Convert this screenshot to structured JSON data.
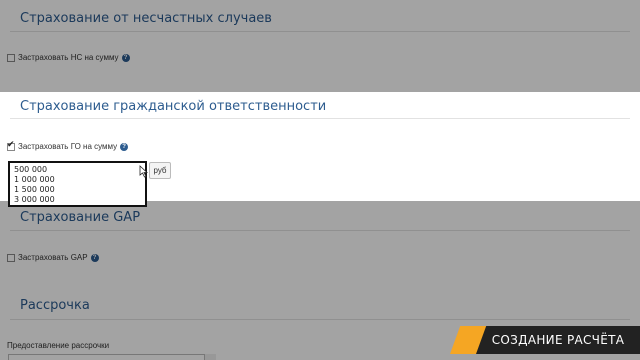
{
  "sections": [
    {
      "title": "Страхование от несчастных случаев",
      "checkbox_label": "Застраховать НС на сумму",
      "checked": false
    },
    {
      "title": "Страхование гражданской ответственности",
      "checkbox_label": "Застраховать ГО на сумму",
      "checked": true
    },
    {
      "title": "Страхование GAP",
      "checkbox_label": "Застраховать GAP",
      "checked": false
    },
    {
      "title": "Рассрочка",
      "field_label": "Предоставление рассрочки"
    }
  ],
  "go_amount": {
    "options": [
      "500 000",
      "1 000 000",
      "1 500 000",
      "3 000 000"
    ],
    "unit": "руб"
  },
  "help_icon": "question-circle-icon",
  "banner": {
    "text": "СОЗДАНИЕ РАСЧЁТА",
    "accent": "#f5a623",
    "bg": "#222222"
  },
  "colors": {
    "title": "#2d5c8f"
  }
}
